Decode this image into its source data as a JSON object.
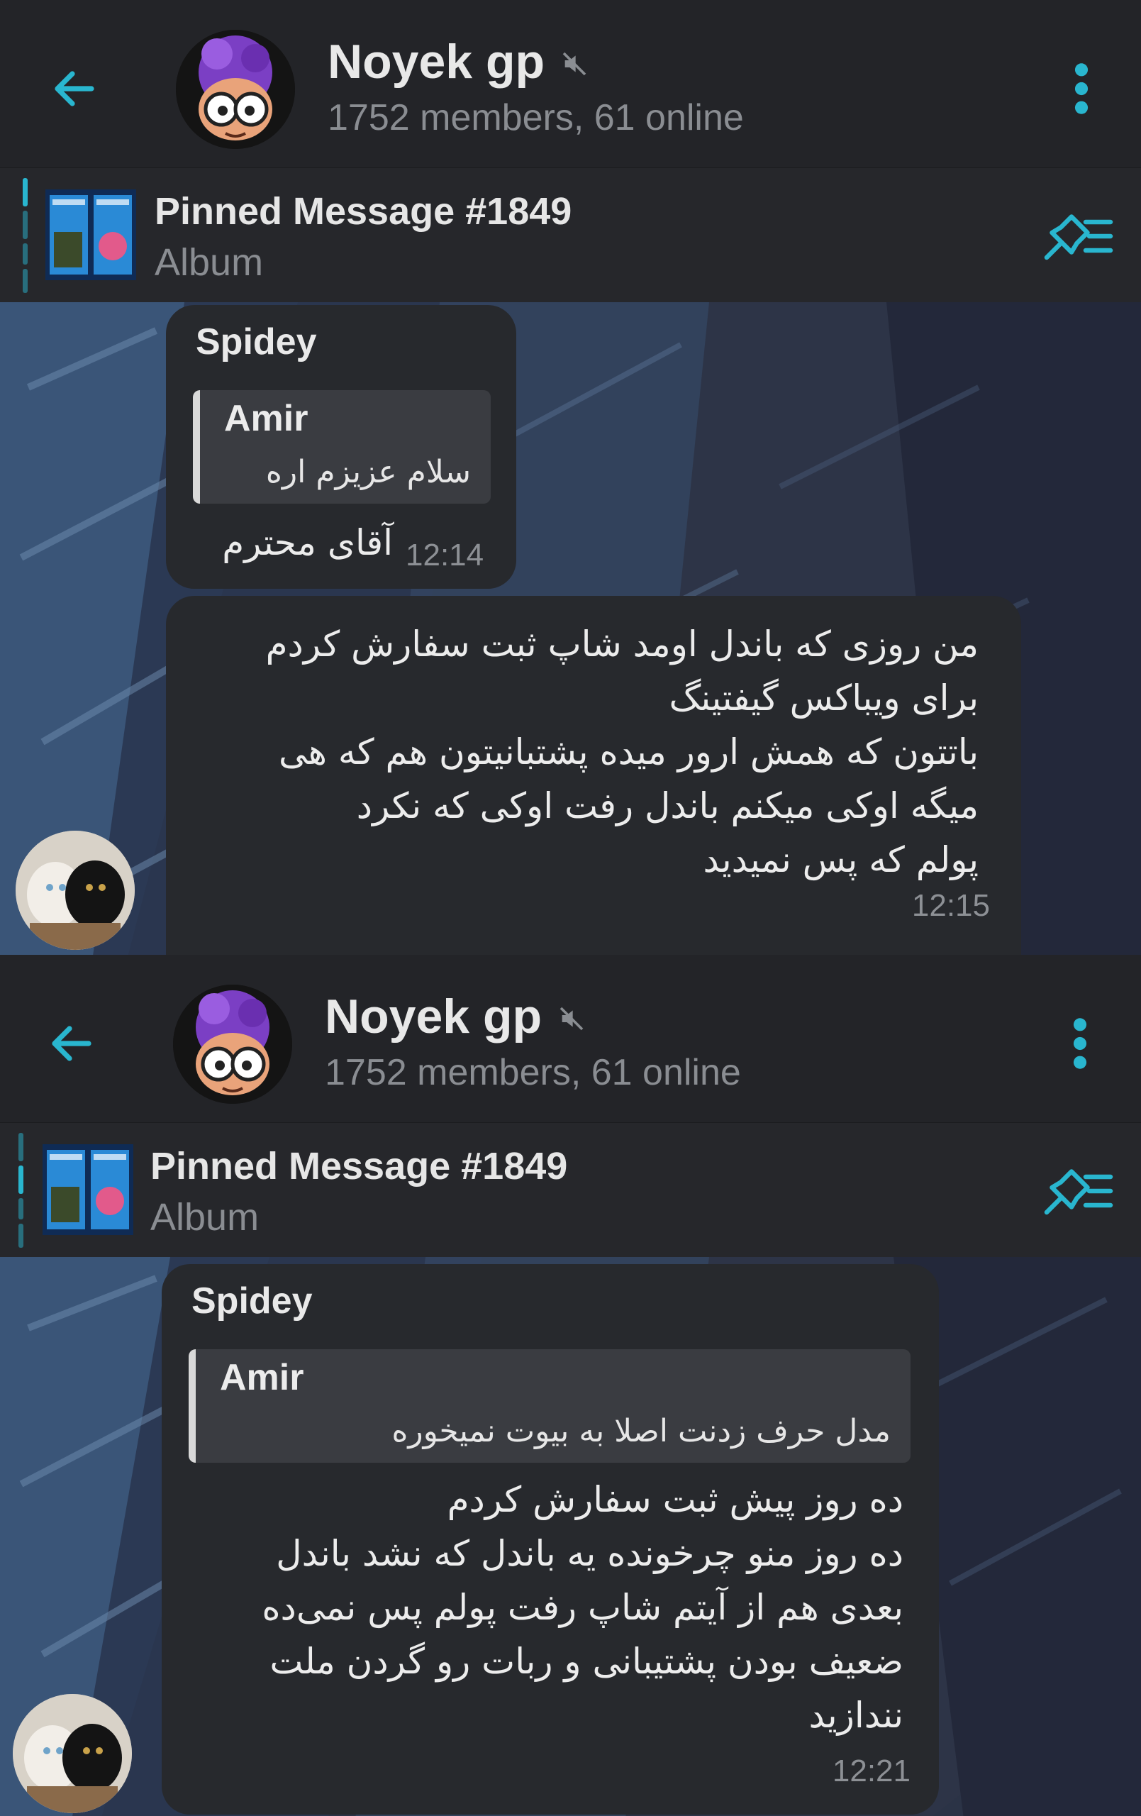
{
  "header": {
    "title": "Noyek gp",
    "subtitle": "1752 members, 61 online"
  },
  "pinned": {
    "title": "Pinned Message #1849",
    "subtitle": "Album"
  },
  "icons": {
    "back": "arrow-left-icon",
    "mute": "speaker-muted-icon",
    "menu": "more-vertical-icon",
    "pinned_list": "pin-list-icon"
  },
  "colors": {
    "accent": "#29b6cf",
    "header_bg": "#232428",
    "bubble_bg": "#27292d",
    "reply_bg": "#3a3c41"
  },
  "panel1": {
    "message1": {
      "sender": "Spidey",
      "reply_name": "Amir",
      "reply_text": "سلام عزیزم اره",
      "text": "آقای محترم",
      "time": "12:14"
    },
    "message2": {
      "lines": [
        "من روزی که باندل اومد شاپ ثبت سفارش کردم",
        "برای ویباکس گیفتینگ",
        "باتتون که همش ارور میده پشتبانیتون هم که هی",
        "میگه اوکی میکنم باندل رفت اوکی که نکرد",
        "پولم که پس نمیدید"
      ],
      "time": "12:15"
    }
  },
  "panel2": {
    "message1": {
      "sender": "Spidey",
      "reply_name": "Amir",
      "reply_text": "مدل حرف زدنت اصلا به بیوت نمیخوره",
      "lines": [
        "ده روز پیش ثبت سفارش کردم",
        "ده روز منو چرخونده یه باندل که نشد باندل",
        "بعدی هم از آیتم شاپ رفت پولم پس نمی‌ده",
        "ضعیف بودن پشتیبانی و ربات رو گردن ملت",
        "نندازید"
      ],
      "time": "12:21"
    }
  }
}
